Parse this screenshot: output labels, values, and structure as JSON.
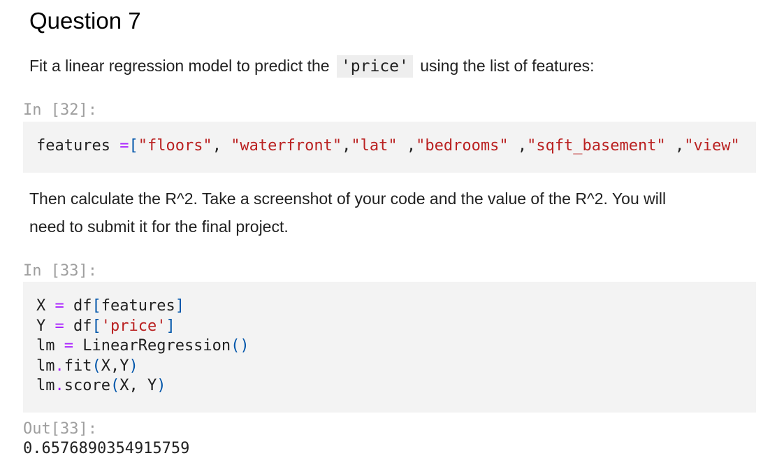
{
  "heading": "Question 7",
  "para1": {
    "before": "Fit a linear regression model to predict the",
    "code": "'price'",
    "after": "using the list of features:"
  },
  "cell32": {
    "prompt": "In [32]:",
    "code": {
      "var": "features ",
      "assign": "=",
      "open": "[",
      "s1": "\"floors\"",
      "c1": ", ",
      "s2": "\"waterfront\"",
      "c2": ",",
      "s3": "\"lat\"",
      "c3": " ,",
      "s4": "\"bedrooms\"",
      "c4": " ,",
      "s5": "\"sqft_basement\"",
      "c5": " ,",
      "s6": "\"view\""
    }
  },
  "para2": {
    "line1": "Then calculate the R^2. Take a screenshot of your code and the value of the R^2. You will",
    "line2": "need to submit it for the final project."
  },
  "cell33": {
    "prompt": "In [33]:",
    "lines": {
      "l1a": "X ",
      "l1op": "=",
      "l1b": " df",
      "l1o": "[",
      "l1c": "features",
      "l1cl": "]",
      "l2a": "Y ",
      "l2op": "=",
      "l2b": " df",
      "l2o": "[",
      "l2s": "'price'",
      "l2cl": "]",
      "l3a": "lm ",
      "l3op": "=",
      "l3b": " LinearRegression",
      "l3p": "()",
      "l4a": "lm",
      "l4dot": ".",
      "l4b": "fit",
      "l4o": "(",
      "l4c": "X,Y",
      "l4cl": ")",
      "l5a": "lm",
      "l5dot": ".",
      "l5b": "score",
      "l5o": "(",
      "l5c": "X, Y",
      "l5cl": ")"
    },
    "out_prompt": "Out[33]:",
    "output": "0.6576890354915759"
  }
}
